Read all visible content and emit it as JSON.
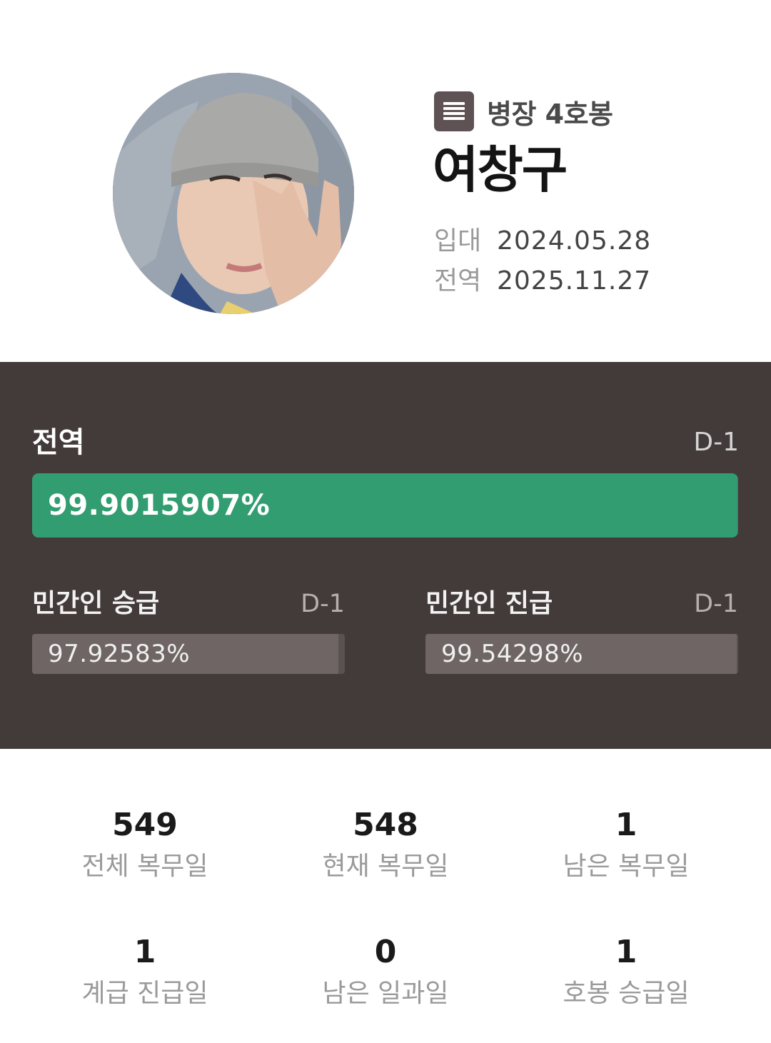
{
  "profile": {
    "avatar_alt": "profile-photo",
    "rank_icon": "list-icon",
    "rank": "병장 4호봉",
    "name": "여창구",
    "enlist_label": "입대",
    "enlist_date": "2024.05.28",
    "discharge_label": "전역",
    "discharge_date": "2025.11.27"
  },
  "progress": {
    "main": {
      "title": "전역",
      "dday": "D-1",
      "percent_text": "99.9015907%",
      "fraction": 0.999015907,
      "color": "#319d71"
    },
    "promotion": {
      "title": "민간인 승급",
      "dday": "D-1",
      "percent_text": "97.92583%",
      "fraction": 0.9792583
    },
    "advancement": {
      "title": "민간인 진급",
      "dday": "D-1",
      "percent_text": "99.54298%",
      "fraction": 0.9954298
    },
    "panel_color": "#433a3a"
  },
  "stats": [
    {
      "value": "549",
      "label": "전체 복무일"
    },
    {
      "value": "548",
      "label": "현재 복무일"
    },
    {
      "value": "1",
      "label": "남은 복무일"
    },
    {
      "value": "1",
      "label": "계급 진급일"
    },
    {
      "value": "0",
      "label": "남은 일과일"
    },
    {
      "value": "1",
      "label": "호봉 승급일"
    }
  ]
}
